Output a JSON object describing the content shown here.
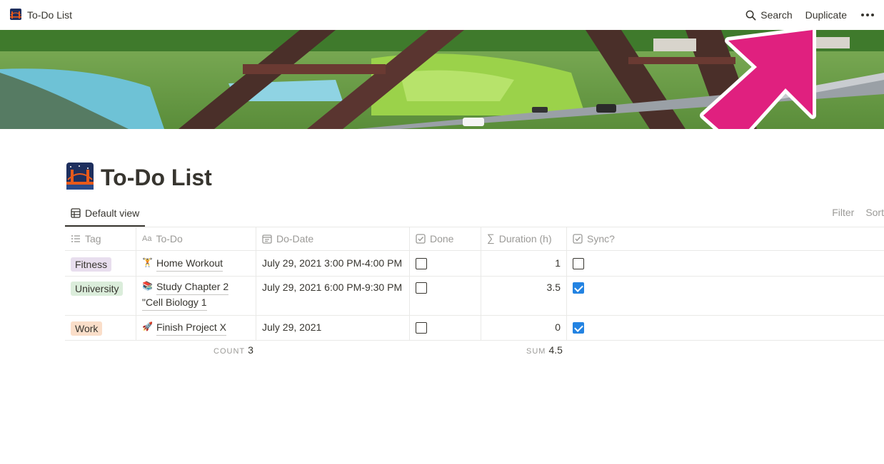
{
  "topbar": {
    "page_title": "To-Do List",
    "search_label": "Search",
    "duplicate_label": "Duplicate"
  },
  "page": {
    "title": "To-Do List"
  },
  "view": {
    "tab_label": "Default view",
    "filter_label": "Filter",
    "sort_label": "Sort"
  },
  "columns": {
    "tag": "Tag",
    "todo": "To-Do",
    "date": "Do-Date",
    "done": "Done",
    "duration": "Duration (h)",
    "sync": "Sync?"
  },
  "rows": [
    {
      "tag": "Fitness",
      "tag_color": "#e8deee",
      "todo": "Home Workout",
      "todo_icon": "🏋",
      "date": "July 29, 2021 3:00 PM-4:00 PM",
      "done": false,
      "duration": "1",
      "sync": false
    },
    {
      "tag": "University",
      "tag_color": "#dbeddb",
      "todo_line1": "Study Chapter 2",
      "todo_line2": "\"Cell Biology 1",
      "todo_icon": "📚",
      "date": "July 29, 2021 6:00 PM-9:30 PM",
      "done": false,
      "duration": "3.5",
      "sync": true
    },
    {
      "tag": "Work",
      "tag_color": "#fadec9",
      "todo": "Finish Project X",
      "todo_icon": "🚀",
      "date": "July 29, 2021",
      "done": false,
      "duration": "0",
      "sync": true
    }
  ],
  "footer": {
    "count_label": "COUNT",
    "count_value": "3",
    "sum_label": "SUM",
    "sum_value": "4.5"
  },
  "colors": {
    "accent": "#2383e2",
    "arrow": "#e0207f"
  }
}
